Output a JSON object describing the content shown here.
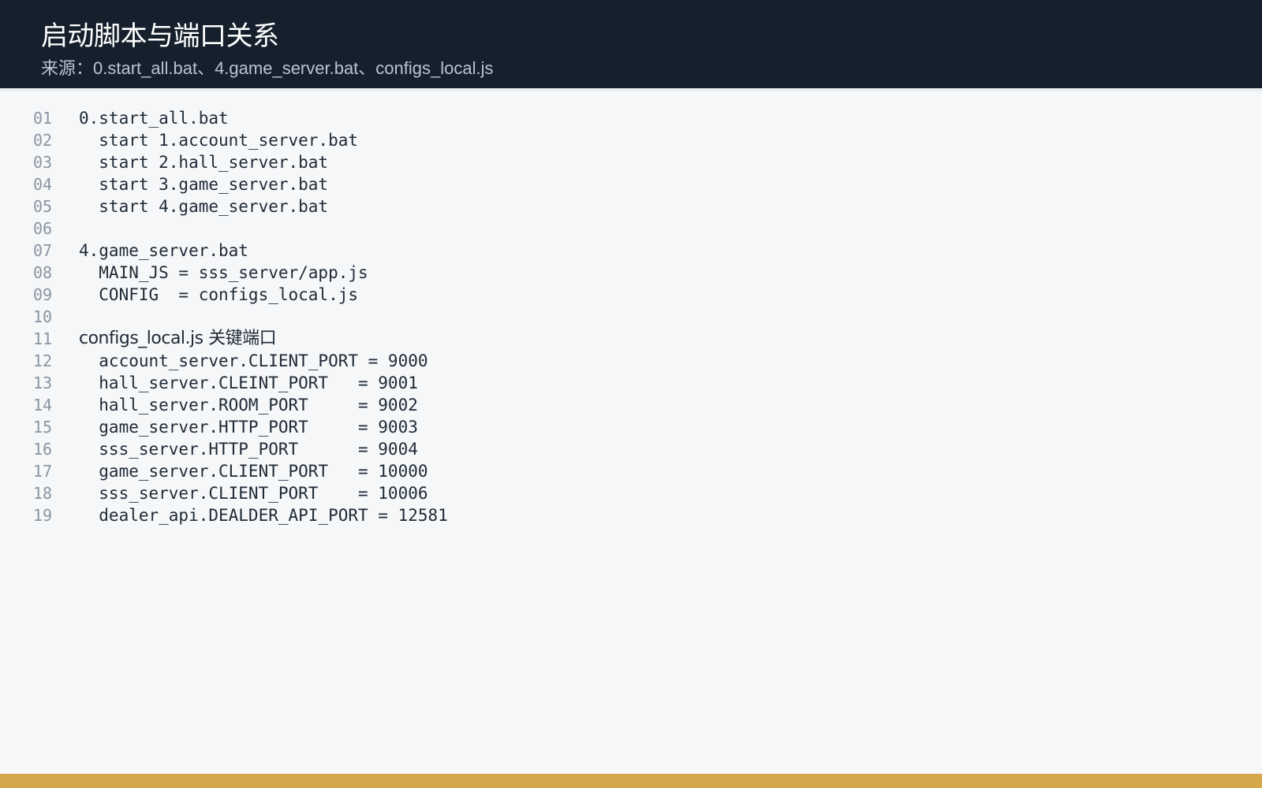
{
  "header": {
    "title": "启动脚本与端口关系",
    "subtitle": "来源：0.start_all.bat、4.game_server.bat、configs_local.js"
  },
  "code_lines": [
    {
      "no": "01",
      "text": "0.start_all.bat"
    },
    {
      "no": "02",
      "text": "  start 1.account_server.bat"
    },
    {
      "no": "03",
      "text": "  start 2.hall_server.bat"
    },
    {
      "no": "04",
      "text": "  start 3.game_server.bat"
    },
    {
      "no": "05",
      "text": "  start 4.game_server.bat"
    },
    {
      "no": "06",
      "text": ""
    },
    {
      "no": "07",
      "text": "4.game_server.bat"
    },
    {
      "no": "08",
      "text": "  MAIN_JS = sss_server/app.js"
    },
    {
      "no": "09",
      "text": "  CONFIG  = configs_local.js"
    },
    {
      "no": "10",
      "text": ""
    },
    {
      "no": "11",
      "text": "configs_local.js 关键端口"
    },
    {
      "no": "12",
      "text": "  account_server.CLIENT_PORT = 9000"
    },
    {
      "no": "13",
      "text": "  hall_server.CLEINT_PORT   = 9001"
    },
    {
      "no": "14",
      "text": "  hall_server.ROOM_PORT     = 9002"
    },
    {
      "no": "15",
      "text": "  game_server.HTTP_PORT     = 9003"
    },
    {
      "no": "16",
      "text": "  sss_server.HTTP_PORT      = 9004"
    },
    {
      "no": "17",
      "text": "  game_server.CLIENT_PORT   = 10000"
    },
    {
      "no": "18",
      "text": "  sss_server.CLIENT_PORT    = 10006"
    },
    {
      "no": "19",
      "text": "  dealer_api.DEALDER_API_PORT = 12581"
    }
  ],
  "colors": {
    "header_bg": "#16202c",
    "page_bg": "#f5f7f9",
    "accent_bar": "#d4a84a",
    "line_number": "#8a95a2",
    "code_text": "#1f2a36"
  }
}
